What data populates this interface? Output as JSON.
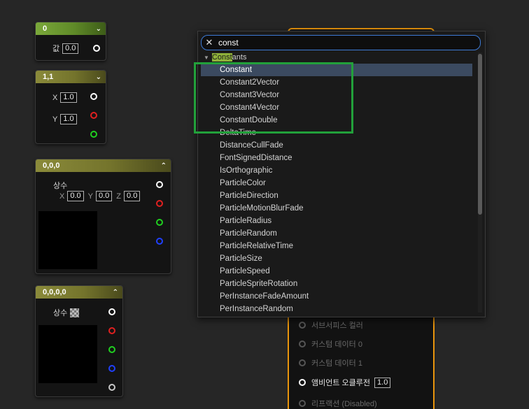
{
  "nodes": {
    "constant": {
      "title": "0",
      "value_label": "값",
      "value": "0.0"
    },
    "constant2": {
      "title": "1,1",
      "x_label": "X",
      "x_value": "1.0",
      "y_label": "Y",
      "y_value": "1.0"
    },
    "constant3": {
      "title": "0,0,0",
      "label": "상수",
      "x_label": "X",
      "x_value": "0.0",
      "y_label": "Y",
      "y_value": "0.0",
      "z_label": "Z",
      "z_value": "0.0"
    },
    "constant4": {
      "title": "0,0,0,0",
      "label": "상수"
    }
  },
  "output_node": {
    "rows": [
      {
        "label": "서브서피스 컬러",
        "active": false
      },
      {
        "label": "커스텀 데이터 0",
        "active": false
      },
      {
        "label": "커스텀 데이터 1",
        "active": false
      },
      {
        "label": "앰비언트 오클루전",
        "active": true,
        "value": "1.0"
      },
      {
        "label": "리프랙션 (Disabled)",
        "active": false
      }
    ]
  },
  "search_menu": {
    "query": "const",
    "category": {
      "highlight": "Const",
      "rest": "ants"
    },
    "items": [
      "Constant",
      "Constant2Vector",
      "Constant3Vector",
      "Constant4Vector",
      "ConstantDouble",
      "DeltaTime",
      "DistanceCullFade",
      "FontSignedDistance",
      "IsOrthographic",
      "ParticleColor",
      "ParticleDirection",
      "ParticleMotionBlurFade",
      "ParticleRadius",
      "ParticleRandom",
      "ParticleRelativeTime",
      "ParticleSize",
      "ParticleSpeed",
      "ParticleSpriteRotation",
      "PerInstanceFadeAmount",
      "PerInstanceRandom"
    ],
    "selected_index": 0
  },
  "colors": {
    "selection": "#3b4a60",
    "annotation_box": "#22a03a",
    "search_border": "#3d7bd6",
    "output_border": "#e8940c"
  }
}
